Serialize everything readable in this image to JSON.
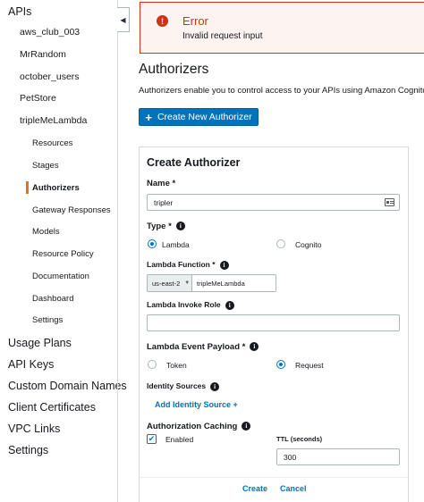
{
  "sidebar": {
    "apis_heading": "APIs",
    "api_list": [
      "aws_club_003",
      "MrRandom",
      "october_users",
      "PetStore",
      "tripleMeLambda"
    ],
    "api_sections": [
      "Resources",
      "Stages",
      "Authorizers",
      "Gateway Responses",
      "Models",
      "Resource Policy",
      "Documentation",
      "Dashboard",
      "Settings"
    ],
    "active_section": "Authorizers",
    "top_items": [
      "Usage Plans",
      "API Keys",
      "Custom Domain Names",
      "Client Certificates",
      "VPC Links",
      "Settings"
    ],
    "collapse_glyph": "◀"
  },
  "error": {
    "icon_glyph": "!",
    "title": "Error",
    "message": "Invalid request input"
  },
  "page": {
    "title": "Authorizers",
    "description": "Authorizers enable you to control access to your APIs using Amazon Cognito",
    "create_button": "Create New Authorizer",
    "create_button_icon": "+"
  },
  "form": {
    "title": "Create Authorizer",
    "name_label": "Name *",
    "name_value": "tripler",
    "type_label": "Type *",
    "type_options": [
      "Lambda",
      "Cognito"
    ],
    "type_selected": "Lambda",
    "lambda_function_label": "Lambda Function *",
    "region": "us-east-2",
    "function_name": "tripleMeLambda",
    "invoke_role_label": "Lambda Invoke Role",
    "invoke_role_value": "",
    "payload_label": "Lambda Event Payload *",
    "payload_options": [
      "Token",
      "Request"
    ],
    "payload_selected": "Request",
    "identity_sources_label": "Identity Sources",
    "add_identity_source": "Add Identity Source +",
    "caching_label": "Authorization Caching",
    "caching_enabled_label": "Enabled",
    "caching_checked": true,
    "checkmark": "✔",
    "ttl_label": "TTL (seconds)",
    "ttl_value": "300",
    "create_action": "Create",
    "cancel_action": "Cancel",
    "info_glyph": "i",
    "caret_glyph": "▼"
  },
  "colors": {
    "accent_blue": "#0073bb",
    "error_red": "#d13212",
    "active_orange": "#ec7211"
  }
}
